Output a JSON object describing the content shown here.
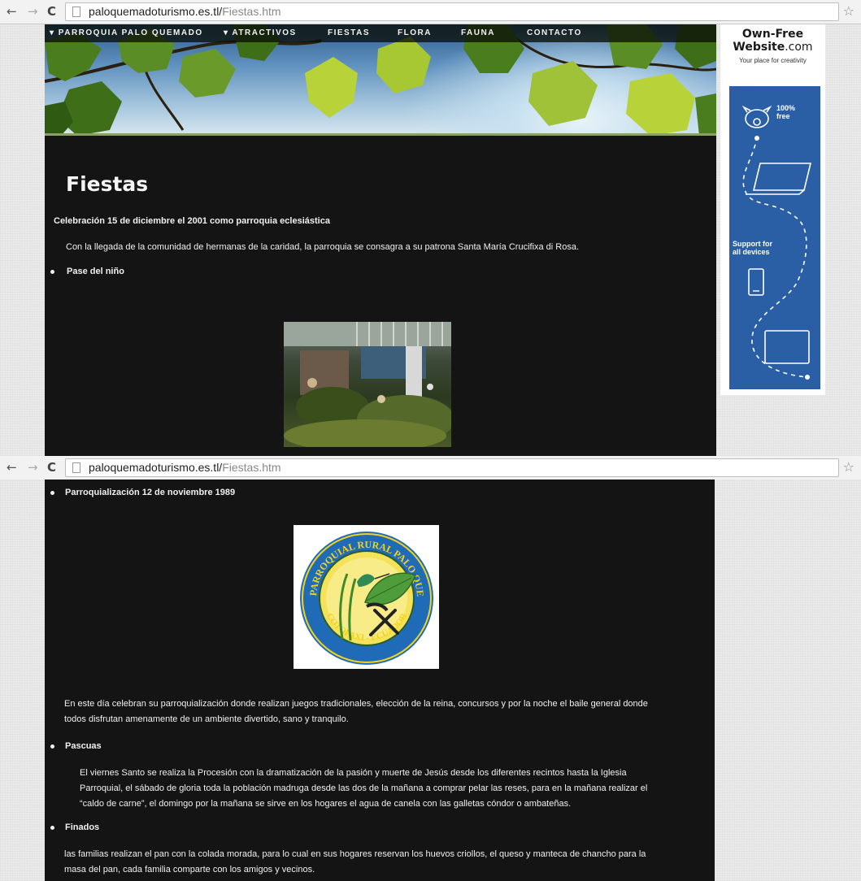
{
  "browser": {
    "back": "←",
    "forward": "→",
    "reload": "C",
    "url_host": "paloquemadoturismo.es.tl/",
    "url_path": "Fiestas.htm",
    "bookmark": "☆"
  },
  "nav": {
    "items": [
      "▾ PARROQUIA PALO QUEMADO",
      "▾ ATRACTIVOS",
      "FIESTAS",
      "FLORA",
      "FAUNA",
      "CONTACTO"
    ]
  },
  "page": {
    "title": "Fiestas",
    "celebration_heading": "Celebración 15 de diciembre el 2001 como parroquia eclesiástica",
    "celebration_text": "Con la llegada de la comunidad de hermanas de la caridad, la parroquia se consagra a su patrona Santa María Crucifixa di Rosa.",
    "pase_heading": "Pase del niño",
    "parroq_heading": "Parroquialización 12 de noviembre 1989",
    "parroq_text_1": "En este día celebran su parroquialización donde realizan juegos tradicionales, elección de la reina, concursos y por la noche el baile general donde",
    "parroq_text_2": "todos disfrutan amenamente de un ambiente divertido, sano y tranquilo.",
    "pascuas_heading": "Pascuas",
    "pascuas_text_1": "El viernes Santo se realiza la Procesión con la dramatización de la pasión y muerte de Jesús desde los diferentes recintos hasta la Iglesia",
    "pascuas_text_2": "Parroquial, el sábado de gloria toda la población madruga desde las dos de la mañana a comprar pelar las reses, para en la mañana realizar el",
    "pascuas_text_3": "“caldo de carne”, el domingo por la mañana se sirve en los hogares el agua de canela con las galletas cóndor o ambateñas.",
    "finados_heading": "Finados",
    "finados_text_1": "las familias realizan el pan con la colada morada, para lo cual en sus hogares reservan  los huevos criollos, el queso y manteca de chancho para la",
    "finados_text_2": "masa del pan, cada familia  comparte con los  amigos y vecinos."
  },
  "logo": {
    "top_text": "G.A.D. PARROQUIAL RURAL PALO QUEMADO",
    "bottom_text": "COTOPAXI - ECUADOR"
  },
  "ad": {
    "brand_line1": "Own-Free",
    "brand_line2a": "Website",
    "brand_line2b": ".com",
    "tagline": "Your place for creativity",
    "free_1": "100%",
    "free_2": "free",
    "support_1": "Support for",
    "support_2": "all devices",
    "accent": "#2a5fa6"
  },
  "colors": {
    "content_bg": "#141414",
    "text": "#f0f0f0"
  }
}
